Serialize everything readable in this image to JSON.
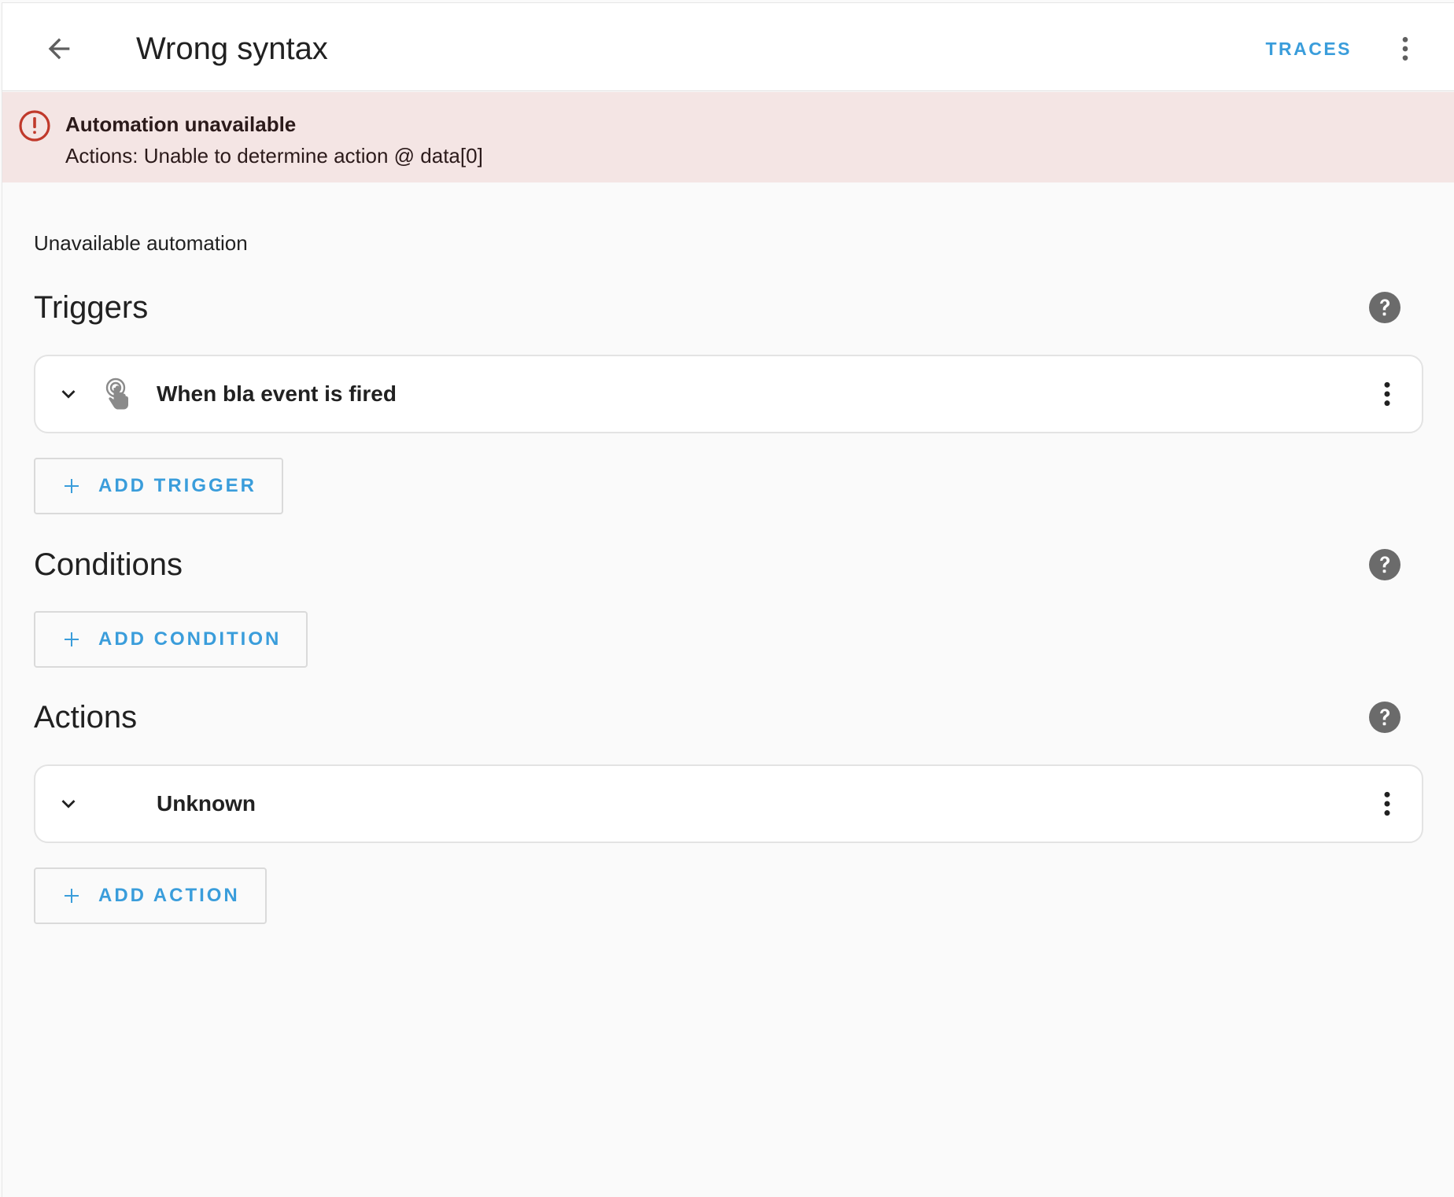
{
  "header": {
    "title": "Wrong syntax",
    "traces_label": "TRACES",
    "back_icon": "arrow-left-icon",
    "menu_icon": "dots-vertical-icon"
  },
  "alert": {
    "icon": "alert-circle-outline-icon",
    "title": "Automation unavailable",
    "message": "Actions: Unable to determine action @ data[0]",
    "color": "#c0392b",
    "background": "#f4e5e4"
  },
  "main": {
    "unavailable_label": "Unavailable automation",
    "triggers": {
      "title": "Triggers",
      "items": [
        {
          "label": "When bla event is fired",
          "icon": "gesture-tap-icon"
        }
      ],
      "add_label": "ADD TRIGGER"
    },
    "conditions": {
      "title": "Conditions",
      "items": [],
      "add_label": "ADD CONDITION"
    },
    "actions": {
      "title": "Actions",
      "items": [
        {
          "label": "Unknown"
        }
      ],
      "add_label": "ADD ACTION"
    }
  },
  "colors": {
    "accent": "#3a9ddb",
    "help_icon": "#6b6b6b",
    "alert_border": "#c0392b"
  }
}
